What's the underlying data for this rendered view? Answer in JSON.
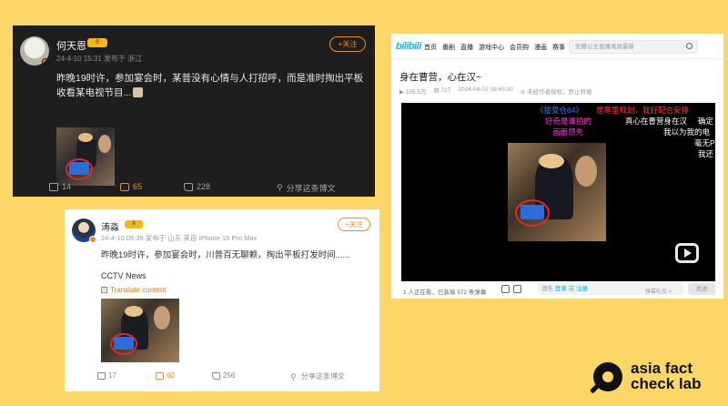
{
  "colors": {
    "background": "#fcd667",
    "weibo_orange": "#f08b16",
    "bili_blue": "#00aeec"
  },
  "weibo_dark": {
    "user_name": "何天恩",
    "badge": "8",
    "meta": "24-4-10 15:31  发布于 浙江",
    "follow_label": "+关注",
    "text": "昨晚19时许，参加宴会时，某普没有心情与人打招呼，而是准时掏出平板收看某电视节目...",
    "footer": {
      "repost": "14",
      "comments": "65",
      "likes": "228",
      "share": "分享这条博文"
    }
  },
  "weibo_light": {
    "user_name": "涛淼",
    "badge": "8",
    "meta": "24-4-10 05:39  发布于 山东  来自 iPhone 15 Pro Max",
    "follow_label": "+关注",
    "text": "昨晚19时许，参加宴会时，川普百无聊赖，掏出平板打发时间......",
    "source": "CCTV News",
    "translate": "Translate content",
    "footer": {
      "repost": "17",
      "comments": "60",
      "likes": "256",
      "share": "分享这条博文"
    }
  },
  "bilibili": {
    "logo": "bilibili",
    "nav": [
      "首页",
      "番剧",
      "直播",
      "游戏中心",
      "会员购",
      "漫画",
      "赛事"
    ],
    "search_placeholder": "安静公主直播录屏最新",
    "title": "身在曹营，心在汉~",
    "stats": {
      "views": "105.5万",
      "danmaku": "727",
      "date": "2024-04-02 09:45:00",
      "notice": "未经作者授权，禁止转载"
    },
    "danmaku": {
      "d1": "《接受仓64》",
      "d2": "是寒里规划，我好配合安排",
      "d3": "好奇是谁拍的",
      "d4": "真心在曹营身在汉",
      "d5": "确定",
      "d6": "画面领先",
      "d7": "我以为我的电",
      "d8": "毫无P",
      "d9": "我还"
    },
    "bar": {
      "watching": "1 人正在看，已装填 572 条弹幕",
      "dm_prefix": "请先",
      "dm_login": "登录",
      "dm_or": "或",
      "dm_register": "注册",
      "etiquette": "弹幕礼仪 >",
      "send": "发送"
    }
  },
  "brand": {
    "line1": "asia fact",
    "line2": "check lab"
  }
}
